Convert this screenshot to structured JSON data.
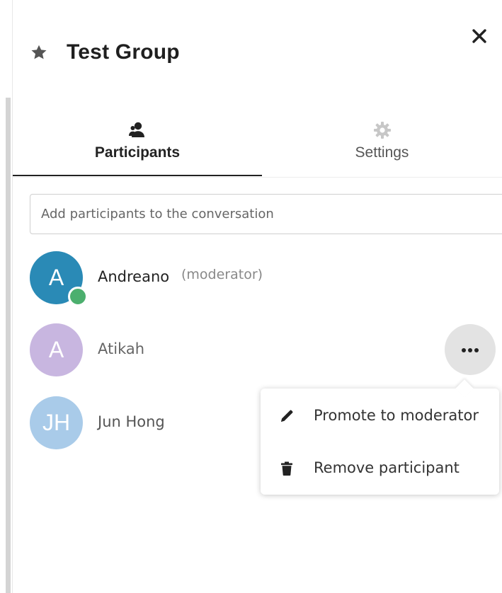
{
  "header": {
    "title": "Test Group"
  },
  "icons": {
    "favorite": "star-icon",
    "close": "close-icon",
    "participants": "user-group-icon",
    "settings": "gear-icon",
    "more": "more-icon",
    "promote": "pencil-icon",
    "remove": "trash-icon"
  },
  "tabs": [
    {
      "label": "Participants",
      "active": true
    },
    {
      "label": "Settings",
      "active": false
    }
  ],
  "search": {
    "placeholder": "Add participants to the conversation"
  },
  "participants": [
    {
      "initials": "A",
      "name": "Andreano",
      "role": "(moderator)",
      "avatar_color": "#2a8ab6",
      "online": true
    },
    {
      "initials": "A",
      "name": "Atikah",
      "role": "",
      "avatar_color": "#c8b6e0",
      "online": false
    },
    {
      "initials": "JH",
      "name": "Jun Hong",
      "role": "",
      "avatar_color": "#a9cbe9",
      "online": false
    }
  ],
  "menu": {
    "items": [
      {
        "label": "Promote to moderator"
      },
      {
        "label": "Remove participant"
      }
    ]
  },
  "colors": {
    "online": "#4caf6e",
    "tab_active_underline": "#222222"
  }
}
